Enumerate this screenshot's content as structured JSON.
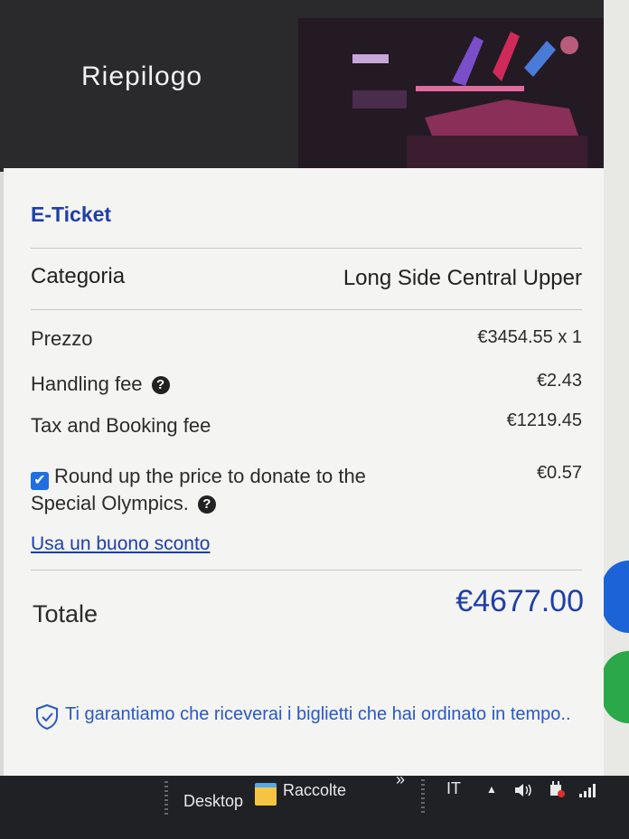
{
  "header": {
    "title": "Riepilogo"
  },
  "ticket": {
    "type_label": "E-Ticket",
    "category_label": "Categoria",
    "category_value": "Long Side Central Upper",
    "price_label": "Prezzo",
    "price_value": "€3454.55 x 1",
    "handling_label": "Handling fee",
    "handling_value": "€2.43",
    "tax_label": "Tax and Booking fee",
    "tax_value": "€1219.45",
    "donate_text": "Round up the price to donate to the Special Olympics.",
    "donate_value": "€0.57",
    "donate_checked": true,
    "coupon_link": "Usa un buono sconto",
    "total_label": "Totale",
    "total_value": "€4677.00",
    "guarantee_text": "Ti garantiamo che riceverai i biglietti che hai ordinato in tempo.."
  },
  "taskbar": {
    "desktop": "Desktop",
    "folder": "Raccolte",
    "chevron": "»",
    "language": "IT",
    "up_arrow": "▲"
  },
  "colors": {
    "accent": "#1f3fa8",
    "header_bg": "#2a2a2c",
    "taskbar_bg": "#1f2125"
  }
}
